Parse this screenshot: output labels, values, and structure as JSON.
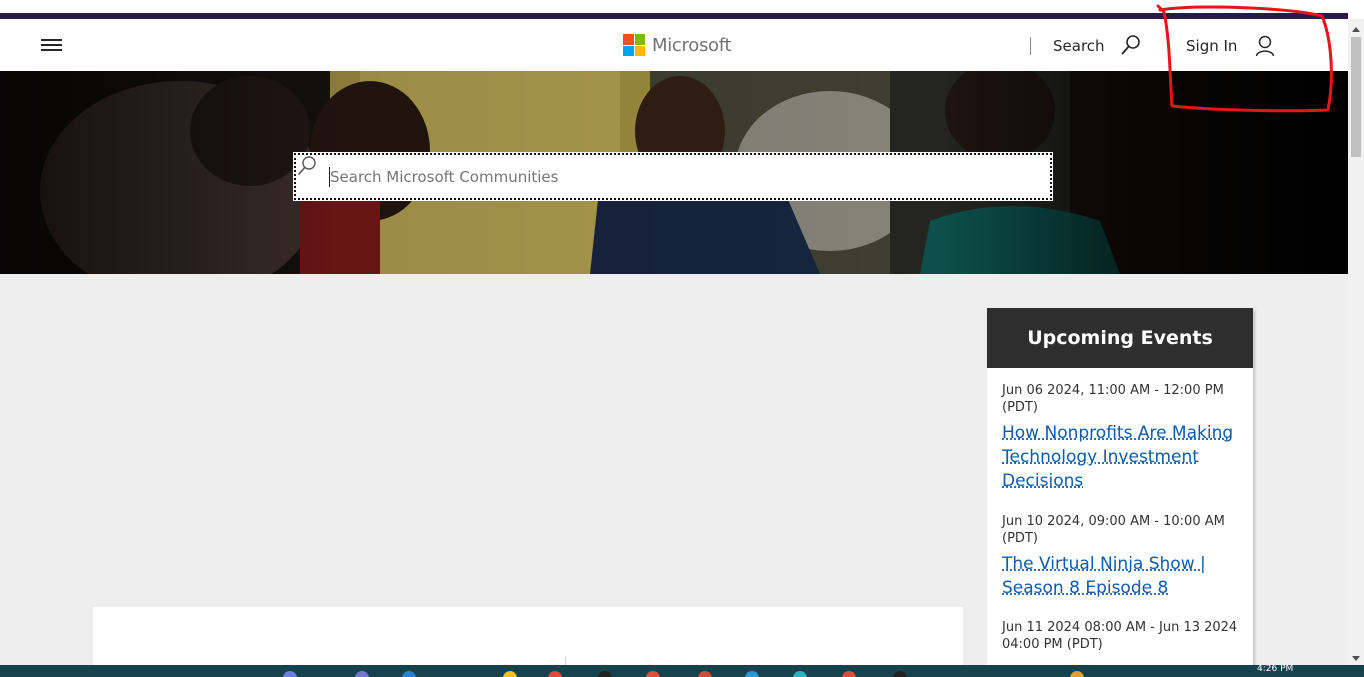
{
  "header": {
    "menu_icon": "hamburger-menu-icon",
    "brand": "Microsoft",
    "search_label": "Search",
    "signin_label": "Sign In",
    "search_icon": "search-icon",
    "user_icon": "user-icon"
  },
  "hero": {
    "search_placeholder": "Search Microsoft Communities",
    "search_icon": "search-icon"
  },
  "events": {
    "title": "Upcoming Events",
    "items": [
      {
        "date": "Jun 06 2024, 11:00 AM - 12:00 PM (PDT)",
        "title": "How Nonprofits Are Making Technology Investment Decisions"
      },
      {
        "date": "Jun 10 2024, 09:00 AM - 10:00 AM (PDT)",
        "title": "The Virtual Ninja Show | Season 8 Episode 8"
      },
      {
        "date": "Jun 11 2024 08:00 AM - Jun 13 2024 04:00 PM (PDT)",
        "title": ""
      }
    ]
  },
  "taskbar": {
    "clock": "4:26 PM"
  },
  "colors": {
    "purple_bar": "#2a1a47",
    "link": "#0f5ba8",
    "events_header": "#2f2f2f",
    "annotation": "#e8141c",
    "ms_red": "#f25022",
    "ms_green": "#7fba00",
    "ms_blue": "#00a4ef",
    "ms_yellow": "#ffb900"
  }
}
